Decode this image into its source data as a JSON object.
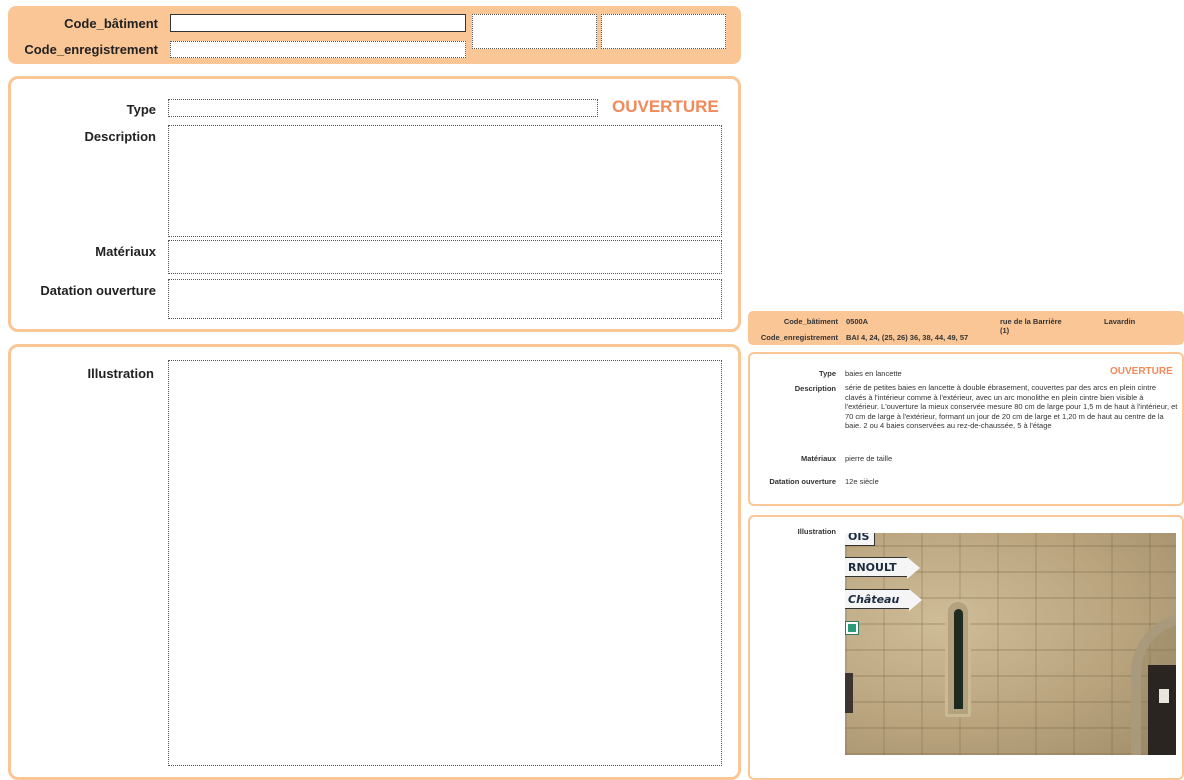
{
  "form": {
    "header": {
      "code_batiment_label": "Code_bâtiment",
      "code_enregistrement_label": "Code_enregistrement"
    },
    "details": {
      "type_label": "Type",
      "description_label": "Description",
      "materiaux_label": "Matériaux",
      "datation_label": "Datation ouverture",
      "category_title": "OUVERTURE"
    },
    "illustration": {
      "label": "Illustration"
    }
  },
  "preview": {
    "header": {
      "code_batiment_label": "Code_bâtiment",
      "code_batiment_value": "0500A",
      "code_enregistrement_label": "Code_enregistrement",
      "code_enregistrement_value": "BAI 4, 24, (25, 26) 36, 38, 44, 49, 57",
      "address": "rue de la Barrière",
      "address_note": "(1)",
      "commune": "Lavardin"
    },
    "details": {
      "type_label": "Type",
      "type_value": "baies en lancette",
      "category_title": "OUVERTURE",
      "description_label": "Description",
      "description_value": "série de petites baies en lancette à double ébrasement, couvertes par des arcs en plein cintre clavés à l'intérieur comme à l'extérieur, avec un arc monolithe en plein cintre bien visible à l'extérieur. L'ouverture la mieux conservée mesure 80 cm de large pour 1,5 m de haut à l'intérieur, et 70 cm de large à l'extérieur, formant un jour de 20 cm de large et 1,20 m de haut au centre de la baie. 2 ou 4 baies conservées au rez-de-chaussée, 5 à l'étage",
      "materiaux_label": "Matériaux",
      "materiaux_value": "pierre de taille",
      "datation_label": "Datation ouverture",
      "datation_value": "12e siècle"
    },
    "illustration": {
      "label": "Illustration",
      "sign_top": "OIS",
      "sign_middle": "RNOULT",
      "sign_bottom": "Château"
    }
  }
}
